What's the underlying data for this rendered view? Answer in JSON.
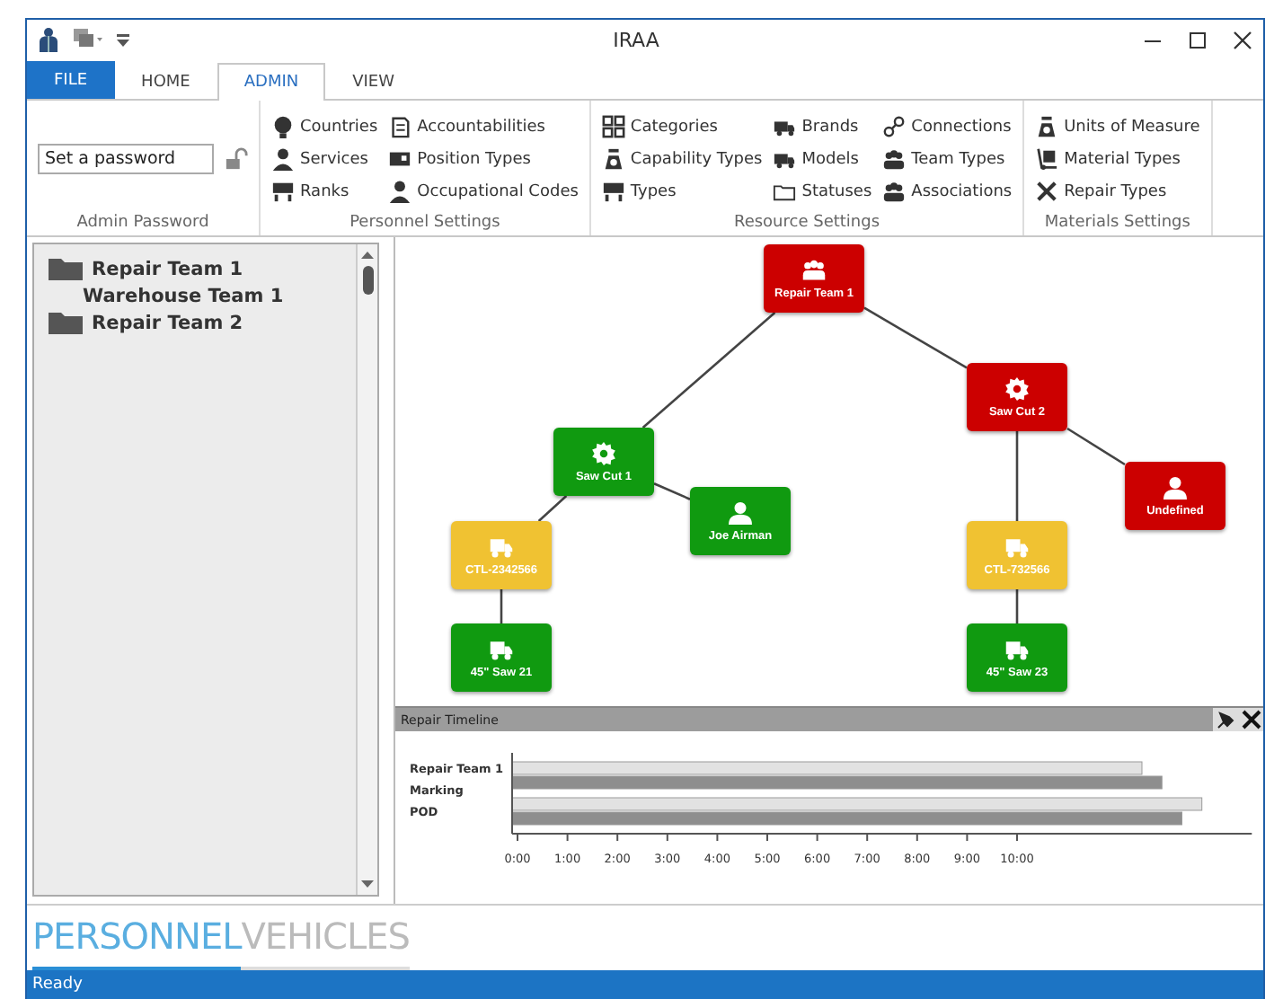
{
  "window": {
    "title": "IRAA"
  },
  "ribbon_tabs": [
    {
      "label": "FILE",
      "kind": "file",
      "selected": false
    },
    {
      "label": "HOME",
      "kind": "tab",
      "selected": false
    },
    {
      "label": "ADMIN",
      "kind": "tab",
      "selected": true
    },
    {
      "label": "VIEW",
      "kind": "tab",
      "selected": false
    }
  ],
  "ribbon_groups": [
    {
      "title": "Admin Password",
      "kind": "password",
      "password": {
        "value": "Set a password"
      }
    },
    {
      "title": "Personnel Settings",
      "kind": "commands",
      "columns": [
        [
          "Countries",
          "Services",
          "Ranks"
        ],
        [
          "Accountabilities",
          "Position Types",
          "Occupational Codes"
        ]
      ]
    },
    {
      "title": "Resource Settings",
      "kind": "commands",
      "columns": [
        [
          "Categories",
          "Capability Types",
          "Types"
        ],
        [
          "Brands",
          "Models",
          "Statuses"
        ],
        [
          "Connections",
          "Team Types",
          "Associations"
        ]
      ]
    },
    {
      "title": "Materials Settings",
      "kind": "commands",
      "columns": [
        [
          "Units of Measure",
          "Material Types",
          "Repair Types"
        ]
      ]
    }
  ],
  "tree": [
    {
      "label": "Repair Team 1",
      "kind": "folder",
      "children": [
        {
          "label": "Warehouse Team 1"
        }
      ]
    },
    {
      "label": "Repair Team 2",
      "kind": "folder"
    }
  ],
  "diagram": {
    "root": {
      "label": "Repair Team 1",
      "kind": "team",
      "color": "#cc0000",
      "children": [
        {
          "label": "Saw Cut 1",
          "kind": "activity",
          "color": "#109a10",
          "children": [
            {
              "label": "CTL-2342566",
              "kind": "vehicle",
              "color": "#f0c232",
              "children": [
                {
                  "label": "45\" Saw 21",
                  "kind": "vehicle",
                  "color": "#109a10"
                }
              ]
            },
            {
              "label": "Joe Airman",
              "kind": "person",
              "color": "#109a10"
            }
          ]
        },
        {
          "label": "Saw Cut 2",
          "kind": "activity",
          "color": "#cc0000",
          "children": [
            {
              "label": "CTL-732566",
              "kind": "vehicle",
              "color": "#f0c232",
              "children": [
                {
                  "label": "45\" Saw 23",
                  "kind": "vehicle",
                  "color": "#109a10"
                }
              ]
            },
            {
              "label": "Undefined",
              "kind": "person",
              "color": "#cc0000"
            }
          ]
        }
      ]
    }
  },
  "timeline": {
    "title": "Repair Timeline",
    "row_labels": [
      "Repair Team 1",
      "Marking",
      "POD"
    ],
    "chart_data": {
      "type": "bar",
      "orientation": "horizontal",
      "xlim": [
        0,
        14.7
      ],
      "xticks": [
        {
          "value": 0,
          "label": "0:00"
        },
        {
          "value": 1,
          "label": "1:00"
        },
        {
          "value": 2,
          "label": "2:00"
        },
        {
          "value": 3,
          "label": "3:00"
        },
        {
          "value": 4,
          "label": "4:00"
        },
        {
          "value": 5,
          "label": "5:00"
        },
        {
          "value": 6,
          "label": "6:00"
        },
        {
          "value": 7,
          "label": "7:00"
        },
        {
          "value": 8,
          "label": "8:00"
        },
        {
          "value": 9,
          "label": "9:00"
        },
        {
          "value": 10,
          "label": "10:00"
        }
      ],
      "series": [
        {
          "color": "#e2e2e2",
          "values": [
            12.5,
            13.7
          ]
        },
        {
          "color": "#8e8e8e",
          "values": [
            12.9,
            13.3
          ]
        }
      ]
    }
  },
  "bottom_tabs": [
    {
      "label": "PERSONNEL",
      "selected": true
    },
    {
      "label": "VEHICLES",
      "selected": false
    }
  ],
  "status_bar": "Ready"
}
